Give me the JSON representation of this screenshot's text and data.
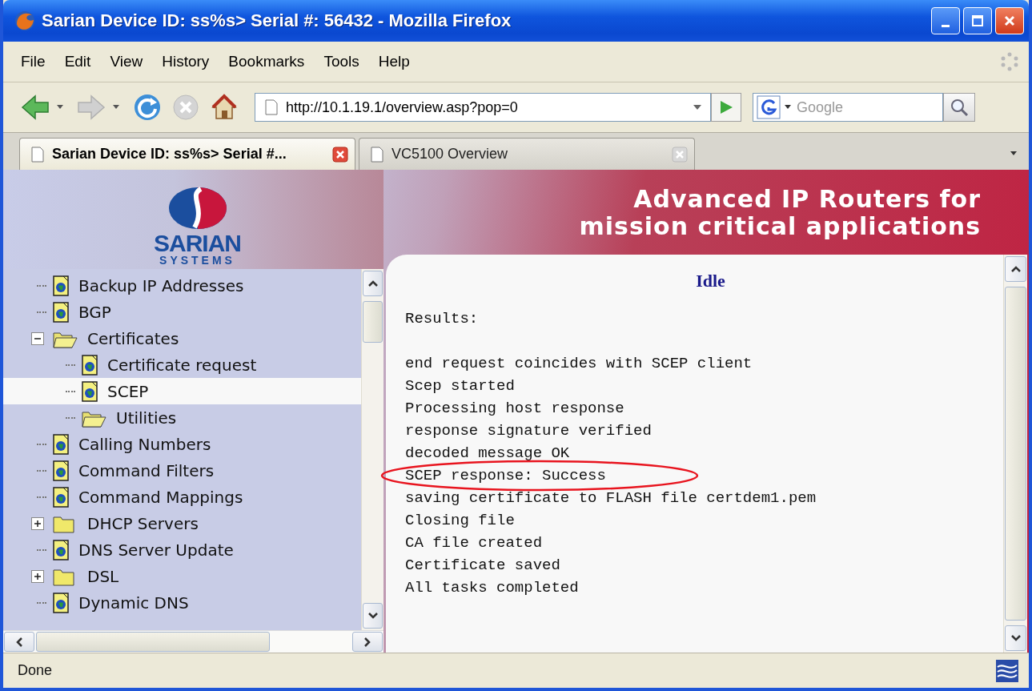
{
  "window": {
    "title": "Sarian Device ID: ss%s> Serial #: 56432 - Mozilla Firefox"
  },
  "menu": [
    "File",
    "Edit",
    "View",
    "History",
    "Bookmarks",
    "Tools",
    "Help"
  ],
  "nav_buttons": [
    {
      "kind": "back",
      "disabled": false
    },
    {
      "kind": "forward",
      "disabled": true
    },
    {
      "kind": "reload",
      "disabled": false
    },
    {
      "kind": "stop",
      "disabled": true
    },
    {
      "kind": "home",
      "disabled": false
    }
  ],
  "address": {
    "value": "http://10.1.19.1/overview.asp?pop=0"
  },
  "search": {
    "placeholder": "Google"
  },
  "tabs": [
    {
      "label": "Sarian Device ID: ss%s> Serial #...",
      "selected": true
    },
    {
      "label": "VC5100 Overview",
      "selected": false
    }
  ],
  "logo": {
    "name": "SARIAN",
    "subtitle": "SYSTEMS"
  },
  "banner": {
    "line_1": "Advanced IP Routers for",
    "line_2": "mission critical applications"
  },
  "tree": {
    "items": [
      {
        "label": "Backup IP Addresses",
        "kind": "page",
        "selected": false
      },
      {
        "label": "BGP",
        "kind": "page",
        "selected": false
      },
      {
        "label": "Certificates",
        "kind": "folder",
        "selected": false,
        "expanded": true,
        "children": [
          {
            "label": "Certificate request",
            "kind": "page",
            "selected": false
          },
          {
            "label": "SCEP",
            "kind": "page",
            "selected": true
          },
          {
            "label": "Utilities",
            "kind": "folder",
            "selected": false
          }
        ]
      },
      {
        "label": "Calling Numbers",
        "kind": "page",
        "selected": false
      },
      {
        "label": "Command Filters",
        "kind": "page",
        "selected": false
      },
      {
        "label": "Command Mappings",
        "kind": "page",
        "selected": false
      },
      {
        "label": "DHCP Servers",
        "kind": "folder",
        "selected": false,
        "expanded": false
      },
      {
        "label": "DNS Server Update",
        "kind": "page",
        "selected": false
      },
      {
        "label": "DSL",
        "kind": "folder",
        "selected": false,
        "expanded": false
      },
      {
        "label": "Dynamic DNS",
        "kind": "page",
        "selected": false
      }
    ]
  },
  "content": {
    "heading": "Idle",
    "label": "Results:",
    "lines": [
      {
        "text": "end request coincides with SCEP client",
        "highlighted": false
      },
      {
        "text": "Scep started",
        "highlighted": false
      },
      {
        "text": "Processing host response",
        "highlighted": false
      },
      {
        "text": "response signature verified",
        "highlighted": false
      },
      {
        "text": "decoded message OK",
        "highlighted": false
      },
      {
        "text": "SCEP response: Success",
        "highlighted": true
      },
      {
        "text": "saving certificate to FLASH file certdem1.pem",
        "highlighted": false
      },
      {
        "text": "Closing file",
        "highlighted": false
      },
      {
        "text": "CA file created",
        "highlighted": false
      },
      {
        "text": "Certificate saved",
        "highlighted": false
      },
      {
        "text": "All tasks completed",
        "highlighted": false
      }
    ]
  },
  "status_bar": {
    "text": "Done"
  }
}
